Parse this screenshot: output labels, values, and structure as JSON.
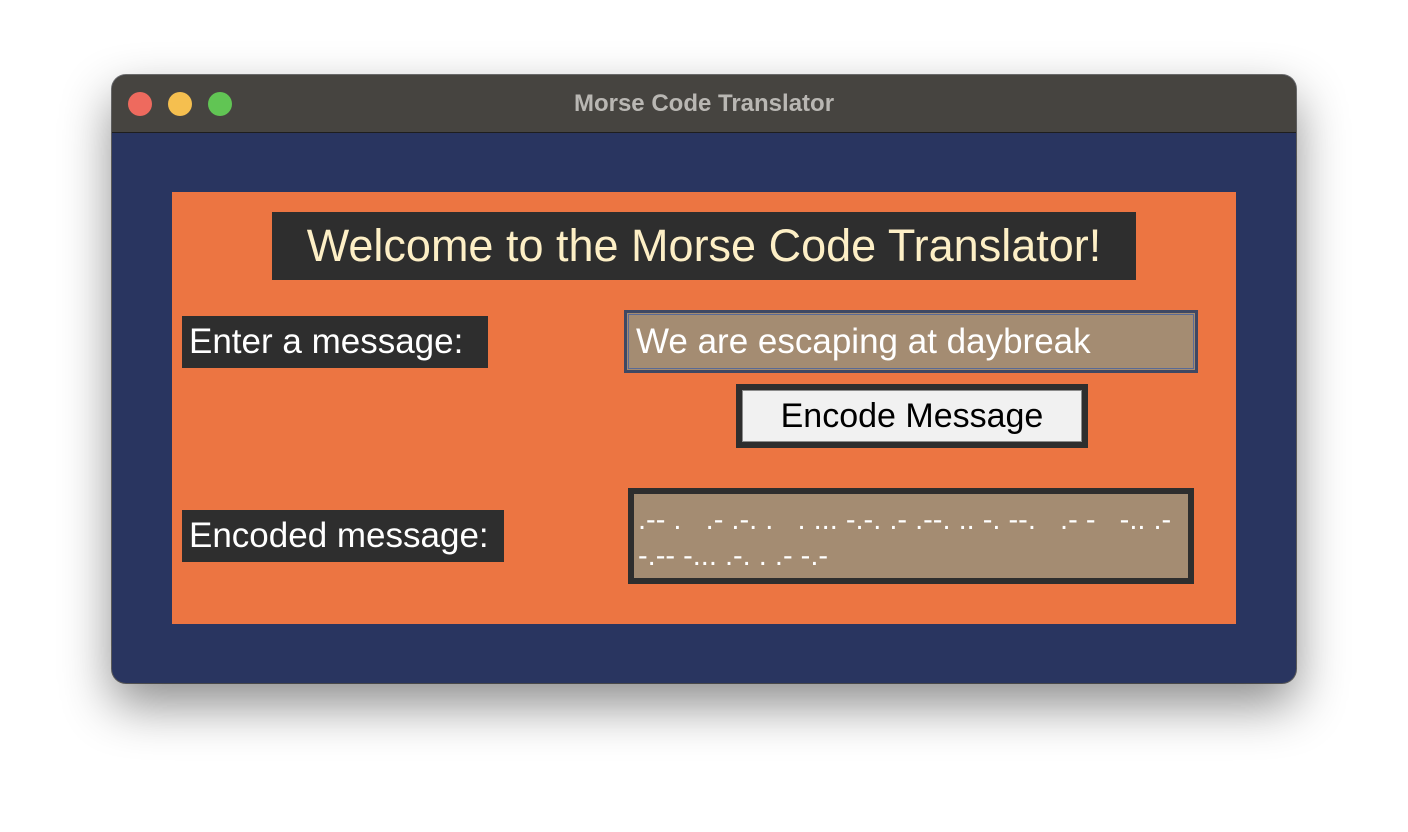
{
  "window": {
    "title": "Morse Code Translator"
  },
  "colors": {
    "window_background": "#293560",
    "panel_background": "#ec7542",
    "label_background": "#2e2e2e",
    "welcome_text": "#fdefc6",
    "field_background": "#a48c72",
    "traffic_close": "#ee6a5e",
    "traffic_minimize": "#f5bf4f",
    "traffic_maximize": "#61c554"
  },
  "header": {
    "welcome_text": "Welcome to the Morse Code Translator!"
  },
  "form": {
    "input_label": "Enter a message:",
    "input_value": "We are escaping at daybreak",
    "encode_button_label": "Encode Message",
    "output_label": "Encoded message:",
    "output_value": ".-- .   .- .-. .   . ... -.-. .- .--. .. -. --.   .- -   -.. .- -.-- -... .-. . .- -.-"
  }
}
